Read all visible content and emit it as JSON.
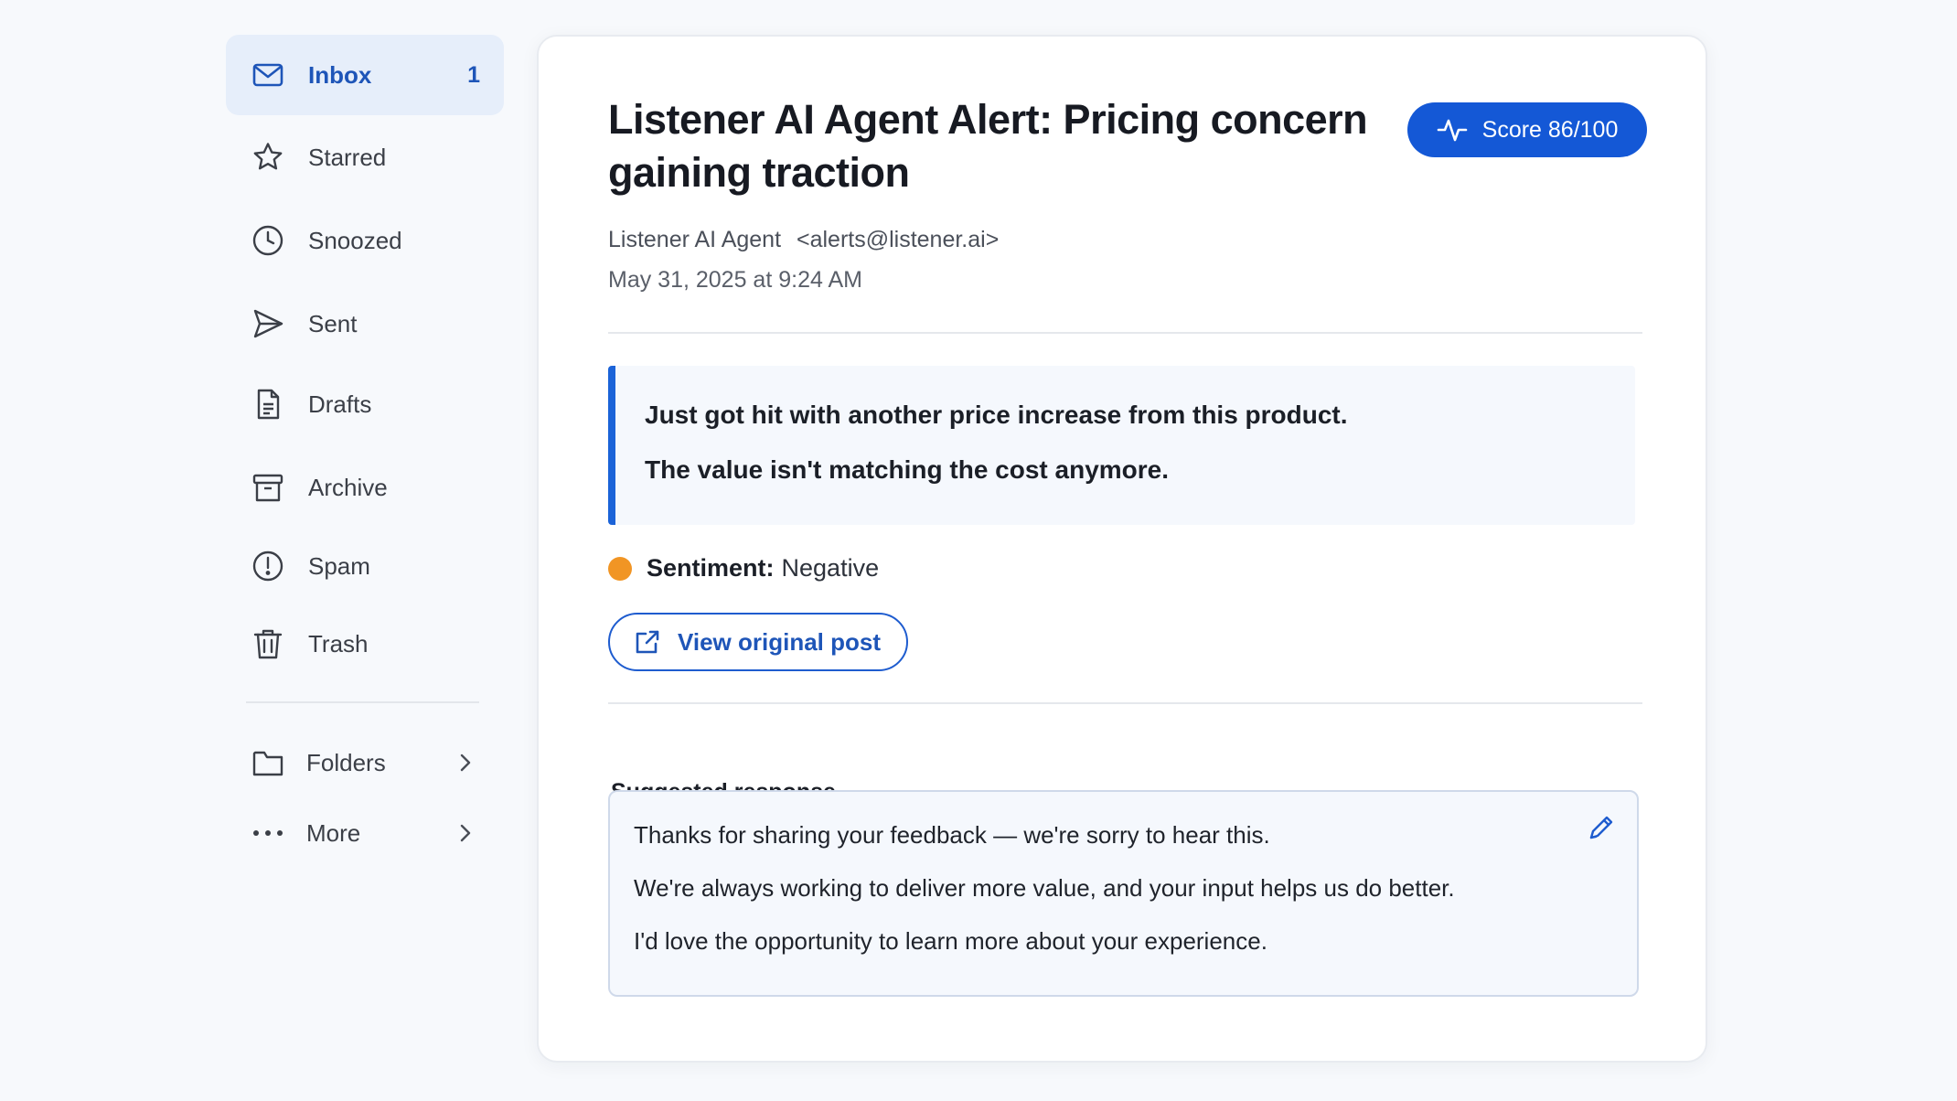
{
  "sidebar": {
    "items": [
      {
        "label": "Inbox",
        "count": "1",
        "icon": "mail-icon"
      },
      {
        "label": "Starred",
        "icon": "star-icon"
      },
      {
        "label": "Snoozed",
        "icon": "clock-icon"
      },
      {
        "label": "Sent",
        "icon": "send-icon"
      },
      {
        "label": "Drafts",
        "icon": "document-icon"
      },
      {
        "label": "Archive",
        "icon": "archive-icon"
      },
      {
        "label": "Spam",
        "icon": "alert-circle-icon"
      },
      {
        "label": "Trash",
        "icon": "trash-icon"
      }
    ],
    "folders_label": "Folders",
    "more_label": "More"
  },
  "email": {
    "subject": "Listener AI Agent Alert: Pricing concern gaining traction",
    "score_label": "Score 86/100",
    "sender_name": "Listener AI Agent",
    "sender_email": "<alerts@listener.ai>",
    "date": "May 31, 2025 at 9:24 AM",
    "quote": [
      "Just got hit with another price increase from this product.",
      "The value isn't matching the cost anymore."
    ],
    "sentiment_key": "Sentiment:",
    "sentiment_value": "Negative",
    "view_post_label": "View original post",
    "suggested_title": "Suggested response",
    "suggested_lines": [
      "Thanks for sharing your feedback — we're sorry to hear this.",
      "We're always working to deliver more value, and your input helps us do better.",
      "I'd love the opportunity to learn more about your experience."
    ]
  },
  "colors": {
    "accent": "#1458d6",
    "active_bg": "#e6eefa",
    "sentiment_negative": "#f19524"
  }
}
